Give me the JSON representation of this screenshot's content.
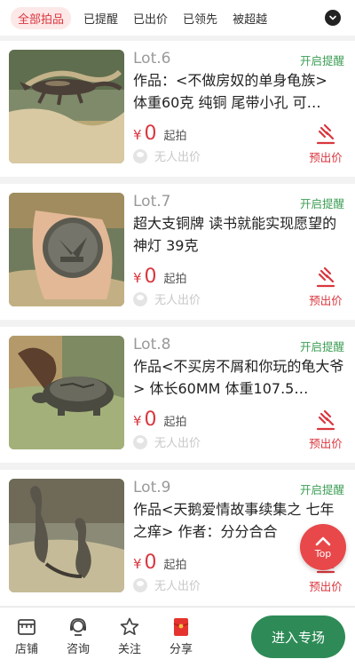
{
  "tabs": {
    "items": [
      "全部拍品",
      "已提醒",
      "已出价",
      "已领先",
      "被超越"
    ],
    "active_index": 0
  },
  "lots": [
    {
      "lot": "Lot.6",
      "remind": "开启提醒",
      "title": "作品：<不做房奴的单身龟族> 体重60克 纯铜 尾带小孔 可…",
      "currency": "¥",
      "price": "0",
      "start": "起拍",
      "bidder": "无人出价",
      "bid": "预出价",
      "image": "bronze-lizard-figurine"
    },
    {
      "lot": "Lot.7",
      "remind": "开启提醒",
      "title": "超大支铜牌 读书就能实现愿望的神灯 39克",
      "currency": "¥",
      "price": "0",
      "start": "起拍",
      "bidder": "无人出价",
      "bid": "预出价",
      "image": "bronze-medallion-in-hand"
    },
    {
      "lot": "Lot.8",
      "remind": "开启提醒",
      "title": "作品<不买房不屑和你玩的龟大爷> 体长60MM 体重107.5…",
      "currency": "¥",
      "price": "0",
      "start": "起拍",
      "bidder": "无人出价",
      "bid": "预出价",
      "image": "bronze-turtle-figurine"
    },
    {
      "lot": "Lot.9",
      "remind": "开启提醒",
      "title": "作品<天鹅爱情故事续集之 七年之痒> 作者：分分合合",
      "currency": "¥",
      "price": "0",
      "start": "起拍",
      "bidder": "无人出价",
      "bid": "预出价",
      "image": "bronze-swan-pair"
    }
  ],
  "top_button": {
    "label": "Top"
  },
  "bottom": {
    "shop": "店铺",
    "consult": "咨询",
    "follow": "关注",
    "share": "分享",
    "enter": "进入专场"
  },
  "colors": {
    "accent_red": "#d9363e",
    "remind_green": "#3c9e55",
    "enter_green": "#2e8b57"
  }
}
